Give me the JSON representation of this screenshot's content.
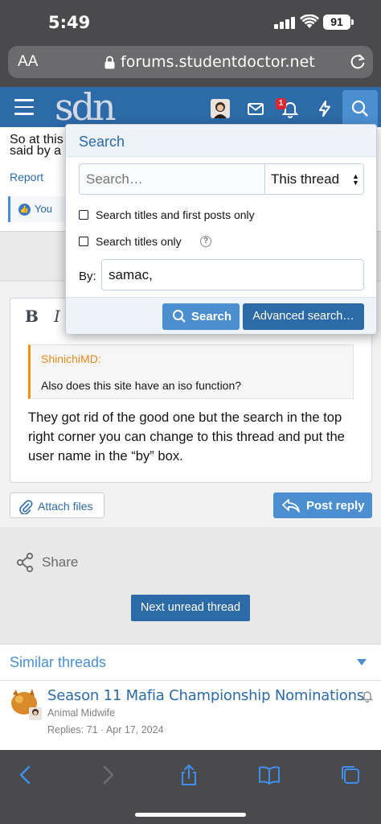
{
  "status_bar": {
    "time": "5:49",
    "battery": "91"
  },
  "browser": {
    "text_size_label": "AA",
    "url": "forums.studentdoctor.net"
  },
  "header": {
    "logo": "sdn",
    "notification_count": "1"
  },
  "post": {
    "text_line1": "So at this",
    "text_line2": "said by a",
    "report_label": "Report",
    "reaction_label": "You"
  },
  "editor": {
    "bold": "B",
    "italic": "I",
    "quote_author": "ShinichiMD:",
    "quote_text": "Also does this site have an iso function?",
    "body": "They got rid of the good one but the search in the top right corner you can change to this thread and put the user name in the “by” box."
  },
  "actions": {
    "attach_label": "Attach files",
    "post_reply_label": "Post reply"
  },
  "share": {
    "label": "Share"
  },
  "next_unread_label": "Next unread thread",
  "similar": {
    "title": "Similar threads",
    "threads": [
      {
        "title": "Season 11 Mafia Championship Nominations",
        "author": "Animal Midwife",
        "meta": "Replies: 71 · Apr 17, 2024"
      }
    ]
  },
  "search_popup": {
    "title": "Search",
    "placeholder": "Search…",
    "scope": "This thread",
    "option_titles_first": "Search titles and first posts only",
    "option_titles_only": "Search titles only",
    "help": "?",
    "by_label": "By:",
    "by_value": "samac,",
    "search_button": "Search",
    "advanced_button": "Advanced search…"
  },
  "colors": {
    "header_blue": "#2d6aa8",
    "accent_blue": "#4b8fd1",
    "quote_orange": "#f2930d",
    "badge_red": "#d9282f"
  },
  "icons": [
    "menu-icon",
    "envelope-icon",
    "bell-icon",
    "lightning-icon",
    "search-icon",
    "lock-icon",
    "reload-icon",
    "paperclip-icon",
    "reply-icon",
    "share-icon",
    "back-icon",
    "forward-icon",
    "share-sheet-icon",
    "bookmarks-icon",
    "tabs-icon"
  ]
}
